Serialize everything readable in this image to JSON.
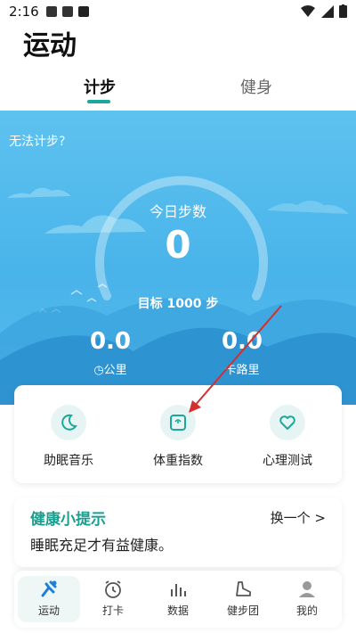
{
  "status": {
    "time": "2:16"
  },
  "header": {
    "title": "运动"
  },
  "tabs": [
    {
      "label": "计步",
      "active": true
    },
    {
      "label": "健身",
      "active": false
    }
  ],
  "steps": {
    "hint": "无法计步?",
    "today_label": "今日步数",
    "today_value": "0",
    "target": "目标 1000 步",
    "progress_fraction": 0,
    "stats": [
      {
        "value": "0.0",
        "label": "公里"
      },
      {
        "value": "0.0",
        "label": "卡路里"
      }
    ]
  },
  "functions": [
    {
      "label": "助眠音乐",
      "icon": "moon-icon"
    },
    {
      "label": "体重指数",
      "icon": "scale-icon"
    },
    {
      "label": "心理测试",
      "icon": "heart-icon"
    }
  ],
  "tip": {
    "title": "健康小提示",
    "more": "换一个 >",
    "text": "睡眠充足才有益健康。"
  },
  "nav": [
    {
      "label": "运动",
      "icon": "run-icon",
      "active": true
    },
    {
      "label": "打卡",
      "icon": "alarm-clock-icon",
      "active": false
    },
    {
      "label": "数据",
      "icon": "bar-chart-icon",
      "active": false
    },
    {
      "label": "健步团",
      "icon": "shoe-icon",
      "active": false
    },
    {
      "label": "我的",
      "icon": "user-icon",
      "active": false
    }
  ],
  "colors": {
    "accent": "#1aa89a",
    "hero_top": "#5ec2ef",
    "hero_bottom": "#49b4ea",
    "arrow": "#d32f2f"
  }
}
